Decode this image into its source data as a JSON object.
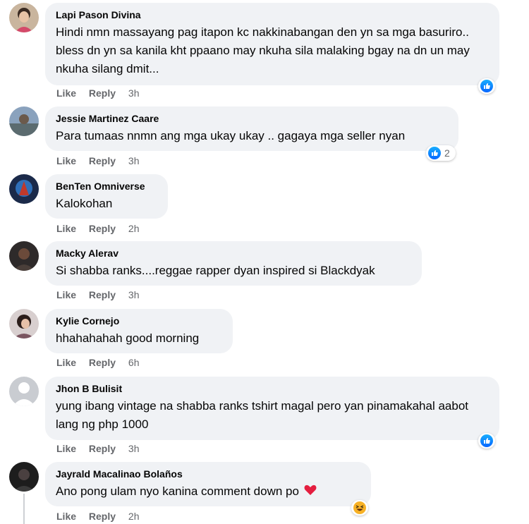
{
  "comments": [
    {
      "name": "Lapi Pason Divina",
      "text": "Hindi nmn massayang pag itapon kc nakkinabangan den yn sa mga basuriro.. bless dn yn sa kanila kht ppaano may nkuha sila malaking bgay na dn un may nkuha silang dmit...",
      "like": "Like",
      "reply": "Reply",
      "time": "3h",
      "reaction": {
        "icon": "like-icon",
        "count": ""
      }
    },
    {
      "name": "Jessie Martinez Caare",
      "text": "Para tumaas nnmn ang mga ukay ukay .. gagaya mga seller nyan",
      "like": "Like",
      "reply": "Reply",
      "time": "3h",
      "reaction": {
        "icon": "like-icon",
        "count": "2"
      }
    },
    {
      "name": "BenTen Omniverse",
      "text": "Kalokohan",
      "like": "Like",
      "reply": "Reply",
      "time": "2h"
    },
    {
      "name": "Macky Alerav",
      "text": "Si shabba ranks....reggae rapper dyan inspired si Blackdyak",
      "like": "Like",
      "reply": "Reply",
      "time": "3h"
    },
    {
      "name": "Kylie Cornejo",
      "text": "hhahahahah good morning",
      "like": "Like",
      "reply": "Reply",
      "time": "6h"
    },
    {
      "name": "Jhon B Bulisit",
      "text": "yung ibang vintage na shabba ranks tshirt magal pero yan pinamakahal aabot lang ng php 1000",
      "like": "Like",
      "reply": "Reply",
      "time": "3h",
      "reaction": {
        "icon": "like-icon",
        "count": ""
      }
    },
    {
      "name": "Jayrald Macalinao Bolaños",
      "text": "Ano pong ulam nyo kanina comment down po",
      "emoji": "❤️",
      "like": "Like",
      "reply": "Reply",
      "time": "2h",
      "reaction": {
        "icon": "haha-icon",
        "count": ""
      }
    }
  ],
  "colors": {
    "bubble": "#f0f2f5",
    "meta": "#65676b",
    "like_blue": "#0866ff",
    "heart": "#e41e3f",
    "haha": "#f7b125"
  }
}
